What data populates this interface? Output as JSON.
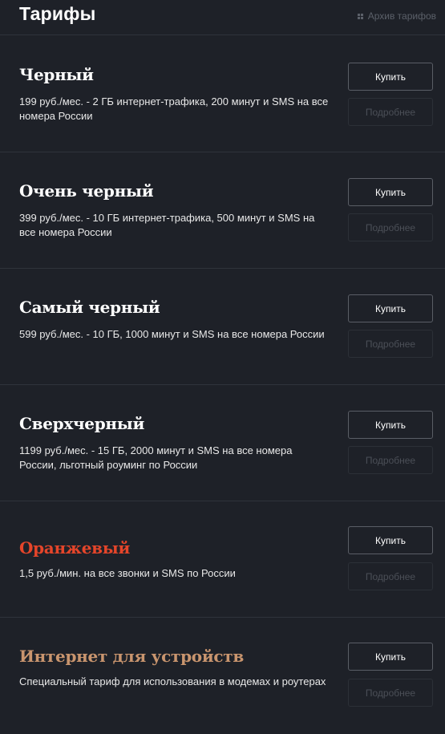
{
  "header": {
    "title": "Тарифы",
    "archive_label": "Архив тарифов"
  },
  "colors": {
    "background": "#1e2128",
    "orange": "#e5452a",
    "tan": "#c9956e"
  },
  "tariffs": [
    {
      "name": "Черный",
      "description": "199 руб./мес. - 2 ГБ интернет-трафика, 200 минут и SMS на все номера России",
      "buy_label": "Купить",
      "more_label": "Подробнее",
      "color": "#ffffff"
    },
    {
      "name": "Очень черный",
      "description": "399 руб./мес. - 10 ГБ интернет-трафика, 500 минут и SMS на все номера России",
      "buy_label": "Купить",
      "more_label": "Подробнее",
      "color": "#ffffff"
    },
    {
      "name": "Самый черный",
      "description": "599 руб./мес. - 10 ГБ, 1000 минут и SMS на все номера России",
      "buy_label": "Купить",
      "more_label": "Подробнее",
      "color": "#ffffff"
    },
    {
      "name": "Сверхчерный",
      "description": "1199 руб./мес. - 15 ГБ, 2000 минут и SMS на все номера России, льготный роуминг по России",
      "buy_label": "Купить",
      "more_label": "Подробнее",
      "color": "#ffffff"
    },
    {
      "name": "Оранжевый",
      "description": "1,5 руб./мин. на все звонки и SMS по России",
      "buy_label": "Купить",
      "more_label": "Подробнее",
      "color": "#e5452a"
    },
    {
      "name": "Интернет для устройств",
      "description": "Специальный тариф для использования в модемах и роутерах",
      "buy_label": "Купить",
      "more_label": "Подробнее",
      "color": "#c9956e"
    }
  ]
}
